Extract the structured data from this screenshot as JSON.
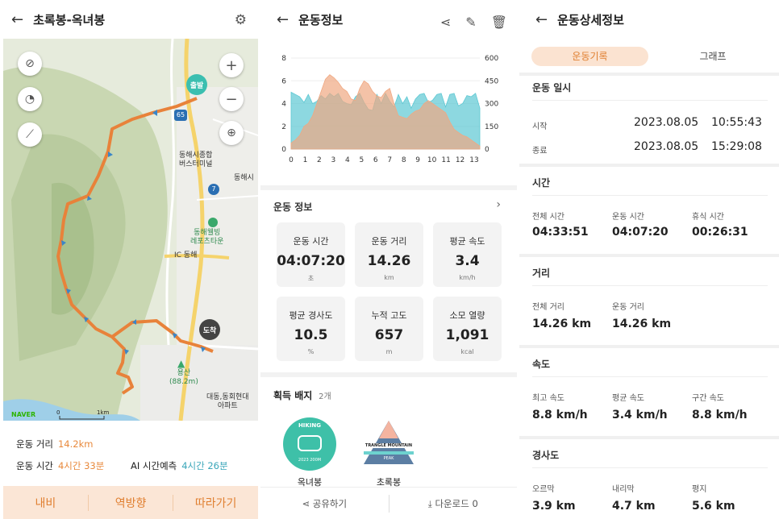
{
  "left": {
    "title": "초록봉-옥녀봉",
    "map": {
      "start_label": "출발",
      "end_label": "도착",
      "route_badge": "65",
      "route_badge2": "7",
      "labels": {
        "terminal": "동해시종합\n버스터미널",
        "city": "동해시",
        "resort": "동해웰빙\n레포츠타운",
        "ic": "IC 동해",
        "mountain": "용산\n(88.2m)",
        "apartment": "대동,동회현대\n아파트"
      },
      "naver": "NAVER",
      "scale_zero": "0",
      "scale_km": "1km"
    },
    "stats": {
      "distance_label": "운동 거리",
      "distance_value": "14.2km",
      "time_label": "운동 시간",
      "time_value": "4시간 33분",
      "ai_label": "AI 시간예측",
      "ai_value": "4시간 26분"
    },
    "buttons": [
      "내비",
      "역방향",
      "따라가기"
    ]
  },
  "middle": {
    "title": "운동정보",
    "chart_data": {
      "type": "area",
      "x_ticks": [
        "0",
        "1",
        "2",
        "3",
        "4",
        "5",
        "6",
        "7",
        "8",
        "9",
        "10",
        "11",
        "12",
        "13"
      ],
      "y_left_ticks": [
        "0",
        "2",
        "4",
        "6",
        "8"
      ],
      "y_right_ticks": [
        "0",
        "150",
        "300",
        "450",
        "600"
      ],
      "ylim_left": [
        0,
        8
      ],
      "ylim_right": [
        0,
        600
      ],
      "grid": true,
      "series": [
        {
          "color": "#5cc8d3",
          "axis": "left",
          "values": [
            5.0,
            4.8,
            4.6,
            4.1,
            4.8,
            4.0,
            4.2,
            4.7,
            4.4,
            4.9,
            4.6,
            4.9,
            4.2,
            4.0,
            3.9,
            4.6,
            4.9,
            4.1,
            3.5,
            3.4,
            4.8,
            4.0,
            4.9,
            4.2,
            3.7,
            4.8,
            4.0,
            4.6,
            3.6,
            4.4,
            4.8,
            4.9,
            4.1,
            4.3,
            4.8,
            4.9,
            3.7,
            4.8,
            4.9,
            3.8,
            4.0,
            4.7,
            4.6,
            4.9,
            3.6
          ]
        },
        {
          "color": "#f0a882",
          "axis": "right",
          "values": [
            40,
            60,
            90,
            150,
            170,
            220,
            300,
            380,
            460,
            490,
            470,
            440,
            400,
            380,
            330,
            320,
            400,
            450,
            430,
            380,
            350,
            340,
            380,
            400,
            300,
            220,
            210,
            200,
            230,
            250,
            260,
            300,
            320,
            300,
            280,
            260,
            240,
            180,
            130,
            110,
            90,
            80,
            60,
            40,
            20
          ]
        }
      ]
    },
    "info_title": "운동 정보",
    "cards": [
      {
        "label": "운동 시간",
        "value": "04:07:20",
        "unit": "초"
      },
      {
        "label": "운동 거리",
        "value": "14.26",
        "unit": "km"
      },
      {
        "label": "평균 속도",
        "value": "3.4",
        "unit": "km/h"
      },
      {
        "label": "평균 경사도",
        "value": "10.5",
        "unit": "%"
      },
      {
        "label": "누적 고도",
        "value": "657",
        "unit": "m"
      },
      {
        "label": "소모 열량",
        "value": "1,091",
        "unit": "kcal"
      }
    ],
    "badges_title": "획득 배지",
    "badges_count": "2개",
    "badges": [
      {
        "name": "옥녀봉",
        "art": "HIKING",
        "art2": "2023 200M"
      },
      {
        "name": "초록봉",
        "art": "TRANGLE MOUNTAIN",
        "art2": "PEAK"
      }
    ],
    "share_label": "공유하기",
    "download_label": "다운로드 0"
  },
  "right": {
    "title": "운동상세정보",
    "tabs": [
      "운동기록",
      "그래프"
    ],
    "datetime": {
      "section": "운동 일시",
      "start_label": "시작",
      "start_date": "2023.08.05",
      "start_time": "10:55:43",
      "end_label": "종료",
      "end_date": "2023.08.05",
      "end_time": "15:29:08"
    },
    "time": {
      "section": "시간",
      "items": [
        {
          "label": "전체 시간",
          "value": "04:33:51"
        },
        {
          "label": "운동 시간",
          "value": "04:07:20"
        },
        {
          "label": "휴식 시간",
          "value": "00:26:31"
        }
      ]
    },
    "distance": {
      "section": "거리",
      "items": [
        {
          "label": "전체 거리",
          "value": "14.26 km"
        },
        {
          "label": "운동 거리",
          "value": "14.26 km"
        }
      ]
    },
    "speed": {
      "section": "속도",
      "items": [
        {
          "label": "최고 속도",
          "value": "8.8 km/h"
        },
        {
          "label": "평균 속도",
          "value": "3.4 km/h"
        },
        {
          "label": "구간 속도",
          "value": "8.8 km/h"
        }
      ]
    },
    "slope": {
      "section": "경사도",
      "items": [
        {
          "label": "오르막",
          "value": "3.9 km"
        },
        {
          "label": "내리막",
          "value": "4.7 km"
        },
        {
          "label": "평지",
          "value": "5.6 km"
        }
      ]
    }
  }
}
